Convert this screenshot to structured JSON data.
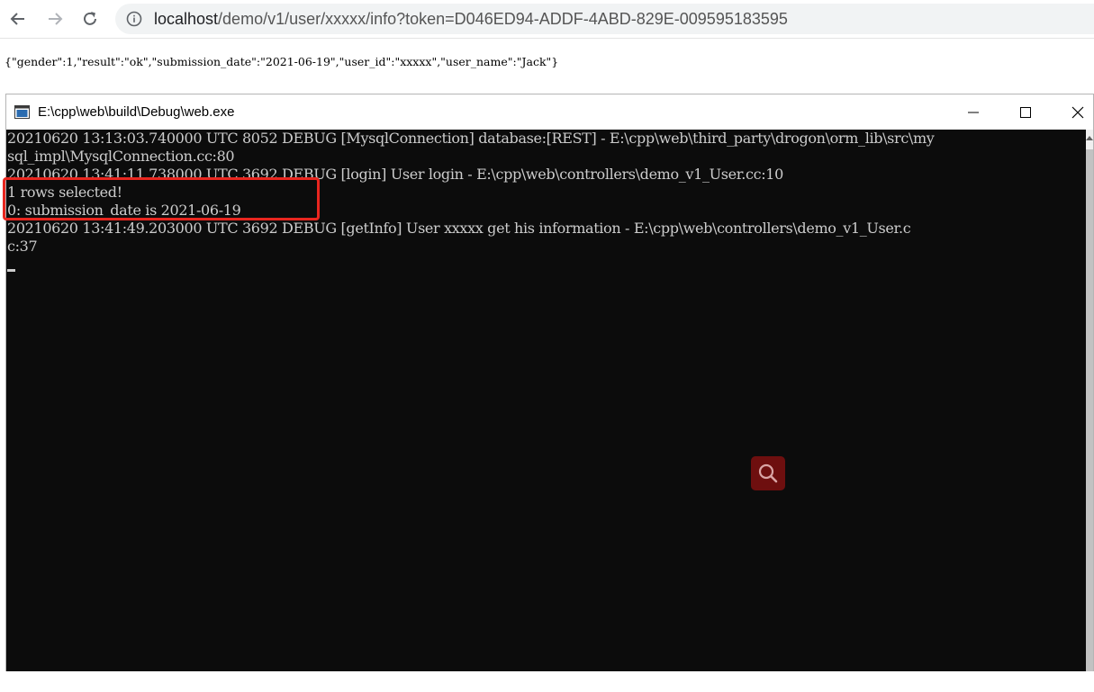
{
  "browser": {
    "url_host": "localhost",
    "url_path": "/demo/v1/user/xxxxx/info?token=D046ED94-ADDF-4ABD-829E-009595183595"
  },
  "page": {
    "json_response": "{\"gender\":1,\"result\":\"ok\",\"submission_date\":\"2021-06-19\",\"user_id\":\"xxxxx\",\"user_name\":\"Jack\"}"
  },
  "console": {
    "title": "E:\\cpp\\web\\build\\Debug\\web.exe",
    "lines": [
      "20210620 13:13:03.740000 UTC 8052 DEBUG [MysqlConnection] database:[REST] - E:\\cpp\\web\\third_party\\drogon\\orm_lib\\src\\my",
      "sql_impl\\MysqlConnection.cc:80",
      "20210620 13:41:11.738000 UTC 3692 DEBUG [login] User  login - E:\\cpp\\web\\controllers\\demo_v1_User.cc:10",
      "1 rows selected!",
      "0: submission_date is 2021-06-19",
      "20210620 13:41:49.203000 UTC 3692 DEBUG [getInfo] User xxxxx get his information - E:\\cpp\\web\\controllers\\demo_v1_User.c",
      "c:37"
    ]
  },
  "icons": {
    "back": "arrow-left-icon",
    "forward": "arrow-right-icon",
    "reload": "reload-icon",
    "info": "info-icon",
    "console_app": "console-app-icon",
    "minimize": "minimize-icon",
    "maximize": "maximize-icon",
    "close": "close-icon",
    "search": "search-icon"
  },
  "colors": {
    "console_background": "#0c0c0c",
    "console_text": "#cccccc",
    "highlight": "#e8261f",
    "search_badge": "#6e0f0f"
  }
}
